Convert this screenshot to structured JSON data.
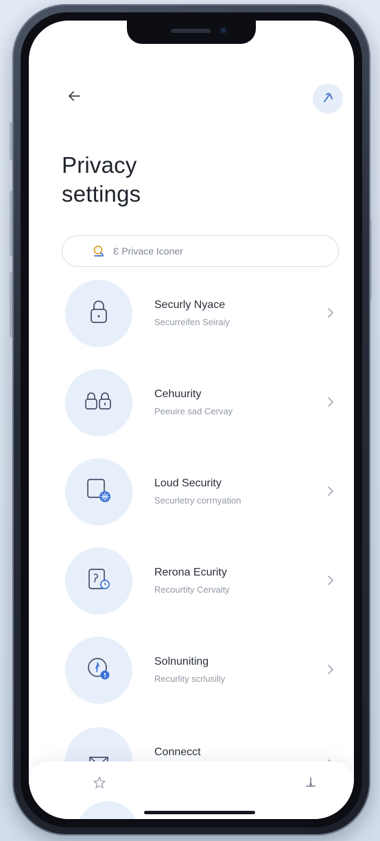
{
  "header": {
    "title_line1": "Privacy",
    "title_line2": "settings",
    "back_icon": "arrow-left-icon",
    "action_icon": "wand-icon"
  },
  "search": {
    "placeholder": "Ɛ Privace Iconer",
    "icon": "search-icon"
  },
  "items": [
    {
      "title": "Securly Nyace",
      "subtitle": "Securreifen Seiraiy",
      "icon": "lock-icon"
    },
    {
      "title": "Cehuurity",
      "subtitle": "Peeuire sad Cervay",
      "icon": "double-lock-icon"
    },
    {
      "title": "Loud Security",
      "subtitle": "Securletry corrnyation",
      "icon": "device-globe-icon"
    },
    {
      "title": "Rerona Ecurity",
      "subtitle": "Recourtity Cervaity",
      "icon": "phone-key-icon"
    },
    {
      "title": "Solnuniting",
      "subtitle": "Recurlity scrlusiliy",
      "icon": "gear-badge-icon"
    },
    {
      "title": "Connecct",
      "subtitle": "",
      "icon": "shield-icon"
    }
  ],
  "bottom_nav": {
    "left_icon": "star-icon",
    "right_icon": "person-icon"
  },
  "colors": {
    "accent": "#3f74d6",
    "icon_bg": "#e7effa",
    "text_primary": "#2a2f39",
    "text_secondary": "#9299a5"
  }
}
